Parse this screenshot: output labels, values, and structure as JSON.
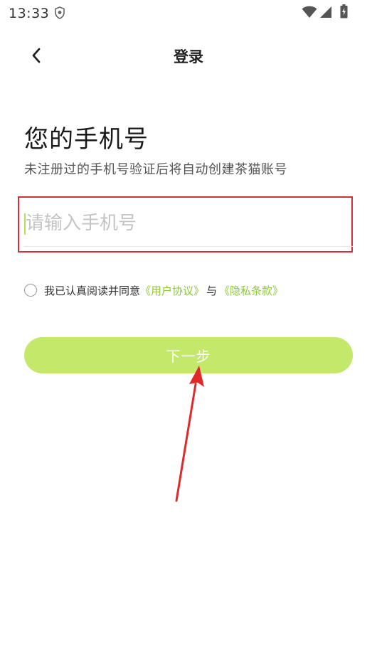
{
  "status_bar": {
    "time": "13:33"
  },
  "nav": {
    "title": "登录",
    "back_icon": "chevron-left-icon"
  },
  "main": {
    "heading": "您的手机号",
    "subheading": "未注册过的手机号验证后将自动创建茶猫账号",
    "phone_input": {
      "value": "",
      "placeholder": "请输入手机号"
    },
    "agreement": {
      "prefix": "我已认真阅读并同意",
      "user_agreement": "《用户协议》",
      "conjunction": "与",
      "privacy_policy": "《隐私条款》",
      "checked": false
    },
    "next_button": "下一步"
  },
  "colors": {
    "accent": "#c3e86a",
    "link": "#8dc63f",
    "highlight": "#d32f3a",
    "arrow": "#e02a2a"
  }
}
